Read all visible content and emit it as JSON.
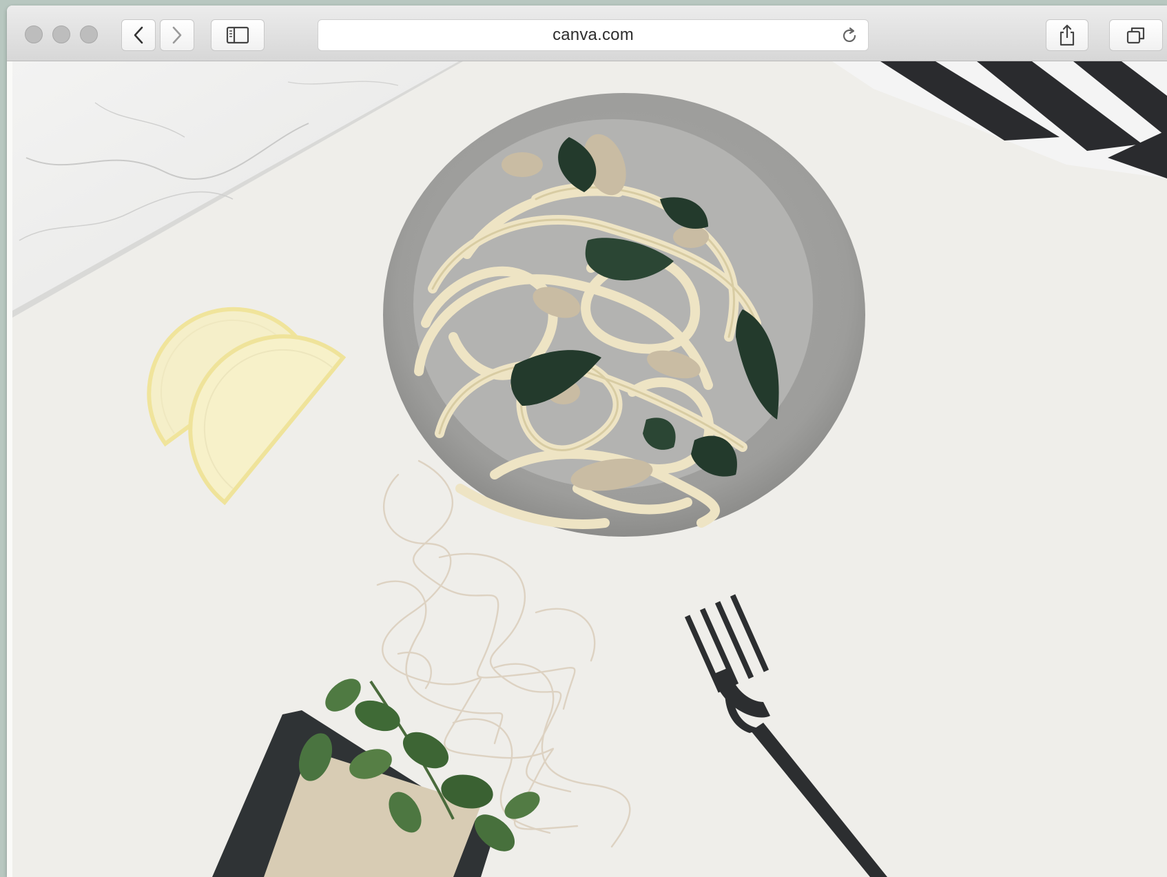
{
  "browser": {
    "address_text": "canva.com",
    "icons": {
      "back": "chevron-left-icon",
      "forward": "chevron-right-icon",
      "sidebar": "sidebar-icon",
      "reload": "reload-icon",
      "share": "share-icon",
      "tabs": "tabs-icon"
    }
  },
  "colors": {
    "toolbar": "#dcdcdc",
    "traffic_lights": "#bdbdbd",
    "surface": "#efeeea"
  }
}
